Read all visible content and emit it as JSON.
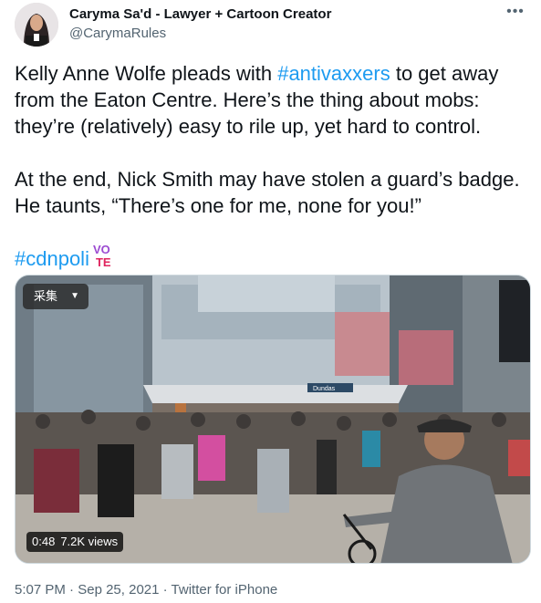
{
  "author": {
    "display_name": "Caryma Sa'd - Lawyer + Cartoon Creator",
    "handle": "@CarymaRules"
  },
  "tweet": {
    "line1_before": "Kelly Anne Wolfe pleads with ",
    "line1_hashtag": "#antivaxxers",
    "line1_after": " to get away from the Eaton Centre. Here’s the thing about mobs: they’re (relatively) easy to rile up, yet hard to control.",
    "paragraph2": "At the end, Nick Smith may have stolen a guard’s badge. He taunts, “There’s one for me, none for you!”",
    "hashtag2": "#cdnpoli",
    "vote_badge": {
      "top": "VO",
      "bottom": "TE"
    }
  },
  "media": {
    "overlay_button": "采集",
    "duration": "0:48",
    "views": "7.2K views",
    "sign_text": "Dundas"
  },
  "footer": {
    "time": "5:07 PM",
    "date": "Sep 25, 2021",
    "source": "Twitter for iPhone",
    "separator": "·"
  },
  "colors": {
    "link": "#1d9bf0",
    "muted": "#536471",
    "text": "#0f1419",
    "vote_pink": "#e0245e",
    "vote_purple": "#9b4ad1"
  },
  "icons": [
    "more-icon",
    "chevron-down-icon"
  ]
}
